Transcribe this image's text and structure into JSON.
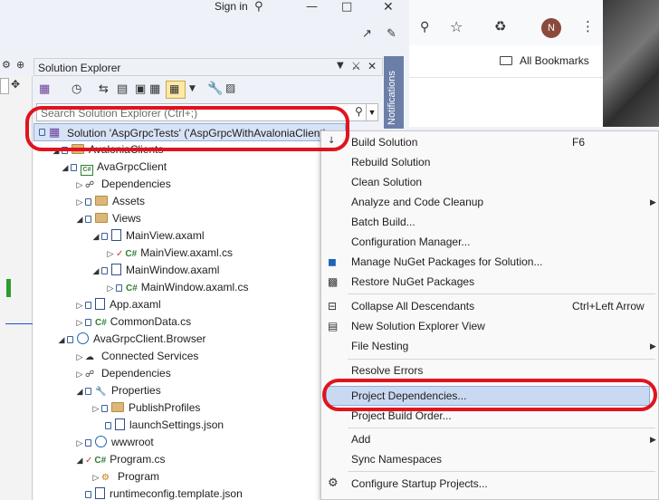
{
  "titlebar": {
    "signin": "Sign in"
  },
  "chrome": {
    "avatar_letter": "N",
    "bookmarks_label": "All Bookmarks"
  },
  "solution_explorer": {
    "title": "Solution Explorer",
    "notifications_tab": "Notifications",
    "search_placeholder": "Search Solution Explorer (Ctrl+;)",
    "solution_label": "Solution 'AspGrpcTests' ('AspGrpcWithAvaloniaClient'",
    "tree": [
      {
        "label": "AvaloniaClients",
        "type": "folder",
        "indent": 0
      },
      {
        "label": "AvaGrpcClient",
        "type": "csproj",
        "indent": 1
      },
      {
        "label": "Dependencies",
        "type": "deps",
        "indent": 2
      },
      {
        "label": "Assets",
        "type": "folder",
        "indent": 2
      },
      {
        "label": "Views",
        "type": "folder",
        "indent": 2
      },
      {
        "label": "MainView.axaml",
        "type": "doc",
        "indent": 3
      },
      {
        "label": "MainView.axaml.cs",
        "type": "cs",
        "indent": 4
      },
      {
        "label": "MainWindow.axaml",
        "type": "doc",
        "indent": 3
      },
      {
        "label": "MainWindow.axaml.cs",
        "type": "cs",
        "indent": 4
      },
      {
        "label": "App.axaml",
        "type": "doc",
        "indent": 2
      },
      {
        "label": "CommonData.cs",
        "type": "cs",
        "indent": 2
      },
      {
        "label": "AvaGrpcClient.Browser",
        "type": "web",
        "indent": 1
      },
      {
        "label": "Connected Services",
        "type": "svc",
        "indent": 2
      },
      {
        "label": "Dependencies",
        "type": "deps",
        "indent": 2
      },
      {
        "label": "Properties",
        "type": "folder",
        "indent": 2
      },
      {
        "label": "PublishProfiles",
        "type": "folder",
        "indent": 3
      },
      {
        "label": "launchSettings.json",
        "type": "doc",
        "indent": 3
      },
      {
        "label": "wwwroot",
        "type": "web",
        "indent": 2
      },
      {
        "label": "Program.cs",
        "type": "cs",
        "indent": 2
      },
      {
        "label": "Program",
        "type": "class",
        "indent": 3
      },
      {
        "label": "runtimeconfig.template.json",
        "type": "doc",
        "indent": 2
      }
    ]
  },
  "context_menu": {
    "items": [
      {
        "label": "Build Solution",
        "shortcut": "F6"
      },
      {
        "label": "Rebuild Solution"
      },
      {
        "label": "Clean Solution"
      },
      {
        "label": "Analyze and Code Cleanup",
        "submenu": true
      },
      {
        "label": "Batch Build..."
      },
      {
        "label": "Configuration Manager..."
      },
      {
        "label": "Manage NuGet Packages for Solution..."
      },
      {
        "label": "Restore NuGet Packages"
      },
      {
        "label": "Collapse All Descendants",
        "shortcut": "Ctrl+Left Arrow"
      },
      {
        "label": "New Solution Explorer View"
      },
      {
        "label": "File Nesting",
        "submenu": true
      },
      {
        "label": "Resolve Errors"
      },
      {
        "label": "Project Dependencies..."
      },
      {
        "label": "Project Build Order..."
      },
      {
        "label": "Add",
        "submenu": true
      },
      {
        "label": "Sync Namespaces"
      },
      {
        "label": "Configure Startup Projects..."
      }
    ]
  },
  "colors": {
    "annotation": "#e0141e",
    "highlight": "#c9d9f2"
  }
}
